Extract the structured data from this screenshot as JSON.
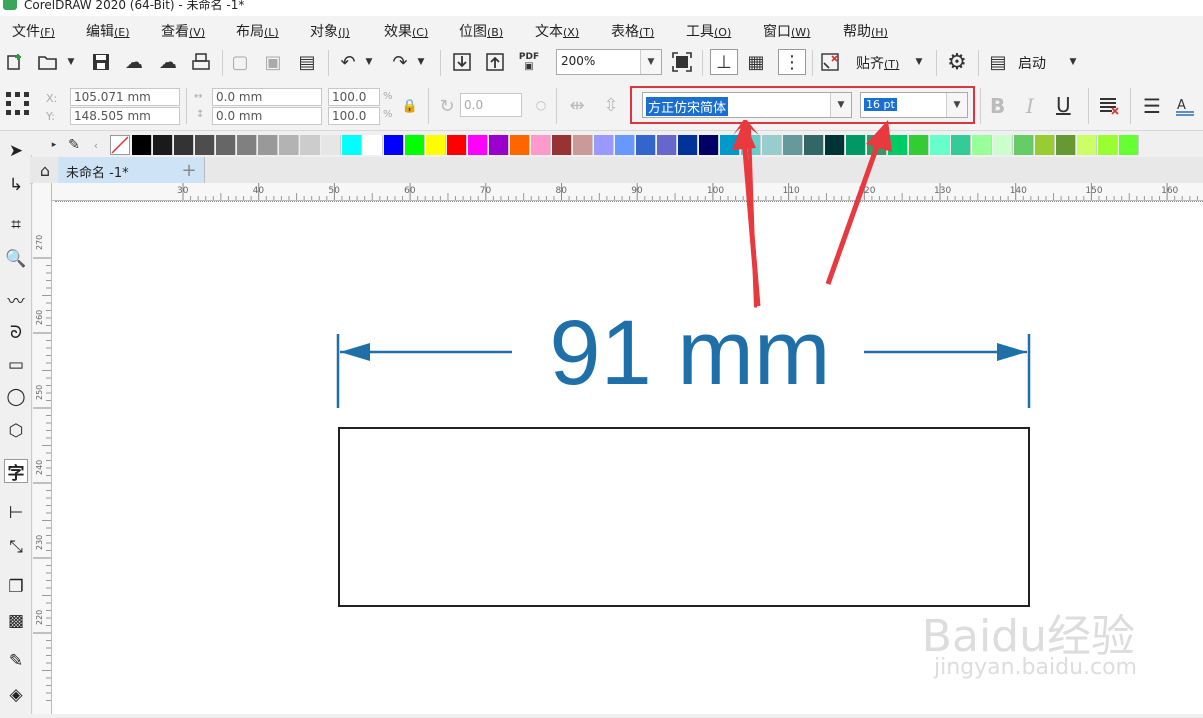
{
  "window": {
    "title": "CorelDRAW 2020 (64-Bit) - 未命名 -1*"
  },
  "menu": [
    {
      "label": "文件",
      "key": "(F)"
    },
    {
      "label": "编辑",
      "key": "(E)"
    },
    {
      "label": "查看",
      "key": "(V)"
    },
    {
      "label": "布局",
      "key": "(L)"
    },
    {
      "label": "对象",
      "key": "(J)"
    },
    {
      "label": "效果",
      "key": "(C)"
    },
    {
      "label": "位图",
      "key": "(B)"
    },
    {
      "label": "文本",
      "key": "(X)"
    },
    {
      "label": "表格",
      "key": "(T)"
    },
    {
      "label": "工具",
      "key": "(O)"
    },
    {
      "label": "窗口",
      "key": "(W)"
    },
    {
      "label": "帮助",
      "key": "(H)"
    }
  ],
  "toolbar": {
    "zoom": "200%",
    "snap_label": "贴齐",
    "snap_key": "(T)",
    "launch_label": "启动",
    "pdf_label": "PDF"
  },
  "properties": {
    "x_label": "X:",
    "y_label": "Y:",
    "x": "105.071 mm",
    "y": "148.505 mm",
    "w": "0.0 mm",
    "h": "0.0 mm",
    "scale_w": "100.0",
    "scale_h": "100.0",
    "percent": "%",
    "rotation": "0.0",
    "font_name": "方正仿宋简体",
    "font_size": "16 pt",
    "bold": "B",
    "italic": "I",
    "underline": "U"
  },
  "document_tab": {
    "label": "未命名 -1*",
    "plus": "+"
  },
  "ruler": {
    "h_ticks": [
      "30",
      "40",
      "50",
      "60",
      "70",
      "80",
      "90",
      "100",
      "110",
      "120",
      "130",
      "140",
      "150",
      "160"
    ],
    "v_ticks": [
      "270",
      "260",
      "250",
      "240",
      "230",
      "220"
    ]
  },
  "canvas": {
    "dimension_text": "91 mm"
  },
  "watermark": {
    "brand": "Baidu经验",
    "url": "jingyan.baidu.com"
  },
  "colors": {
    "accent_blue": "#1f6fa8",
    "highlight_red": "#d9363e",
    "palette": [
      "#000000",
      "#1a1a1a",
      "#333333",
      "#4d4d4d",
      "#666666",
      "#808080",
      "#999999",
      "#b3b3b3",
      "#cccccc",
      "#e6e6e6",
      "#00ffff",
      "#ffffff",
      "#0000ff",
      "#00ff00",
      "#ffff00",
      "#ff0000",
      "#ff00ff",
      "#9900cc",
      "#ff6600",
      "#ff99cc",
      "#993333",
      "#cc9999",
      "#9999ff",
      "#6699ff",
      "#3366cc",
      "#6666cc",
      "#003399",
      "#000066",
      "#0099cc",
      "#66cccc",
      "#99cccc",
      "#669999",
      "#336666",
      "#003333",
      "#009966",
      "#339966",
      "#00cc66",
      "#33cc33",
      "#66ffcc",
      "#33cc99",
      "#99ff99",
      "#ccffcc",
      "#66cc66",
      "#99cc33",
      "#669933",
      "#ccff66",
      "#99ff33",
      "#66ff33"
    ]
  }
}
